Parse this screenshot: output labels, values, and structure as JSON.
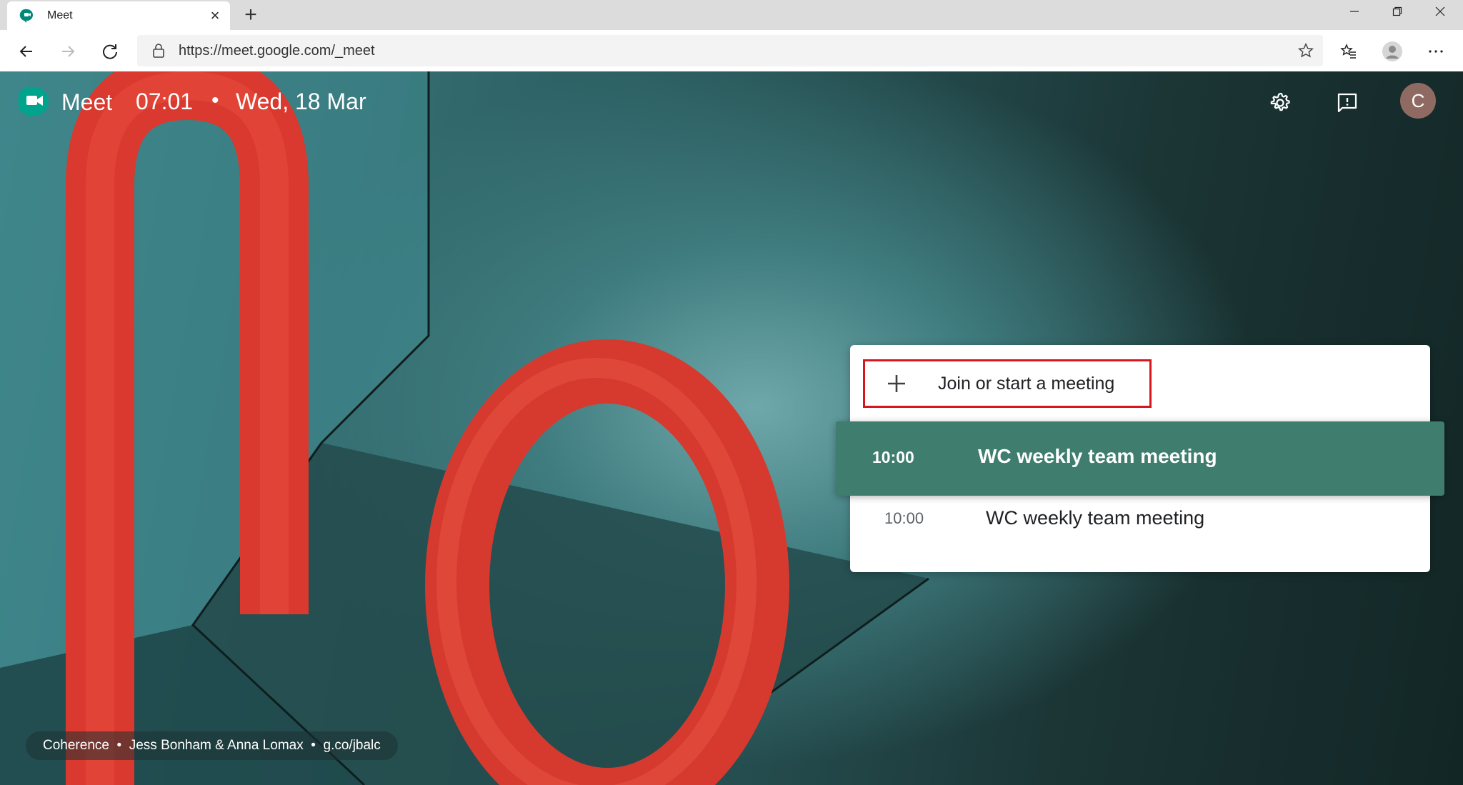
{
  "browser": {
    "tab_title": "Meet",
    "new_tab_symbol": "+",
    "close_symbol": "×",
    "url": "https://meet.google.com/_meet"
  },
  "header": {
    "app_name": "Meet",
    "time": "07:01",
    "separator": "•",
    "date": "Wed, 18 Mar",
    "avatar_initial": "C"
  },
  "card": {
    "join_label": "Join or start a meeting",
    "meetings": [
      {
        "time": "10:00",
        "title": "WC weekly team meeting",
        "highlighted": true
      },
      {
        "time": "10:00",
        "title": "WC weekly team meeting",
        "highlighted": false
      }
    ]
  },
  "credit": {
    "title": "Coherence",
    "dot": "  •  ",
    "artists": "Jess Bonham & Anna Lomax",
    "link": "g.co/jbalc"
  },
  "colors": {
    "highlight_row": "#3f7d6e",
    "annotation_box": "#d9161c",
    "avatar": "#8f6a62"
  },
  "icons": [
    "meet-favicon-icon",
    "close-icon",
    "back-arrow-icon",
    "forward-arrow-icon",
    "refresh-icon",
    "lock-icon",
    "star-icon",
    "favorites-icon",
    "profile-icon",
    "more-icon",
    "settings-gear-icon",
    "feedback-icon",
    "plus-icon"
  ]
}
